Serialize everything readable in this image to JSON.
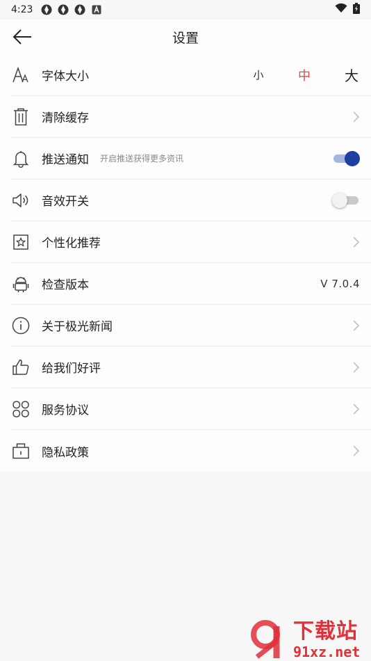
{
  "status_bar": {
    "time": "4:23"
  },
  "header": {
    "title": "设置"
  },
  "settings": {
    "font_size": {
      "label": "字体大小",
      "options": [
        "小",
        "中",
        "大"
      ],
      "selected": "中"
    },
    "clear_cache": {
      "label": "清除缓存"
    },
    "push": {
      "label": "推送通知",
      "sub": "开启推送获得更多资讯",
      "enabled": true
    },
    "sound": {
      "label": "音效开关",
      "enabled": false
    },
    "personal": {
      "label": "个性化推荐"
    },
    "version": {
      "label": "检查版本",
      "value": "V 7.0.4"
    },
    "about": {
      "label": "关于极光新闻"
    },
    "rate": {
      "label": "给我们好评"
    },
    "terms": {
      "label": "服务协议"
    },
    "privacy": {
      "label": "隐私政策"
    }
  },
  "watermark": {
    "brand": "下载站",
    "url": "91xz.net"
  },
  "colors": {
    "accent_red": "#e34c3f",
    "toggle_on": "#1d3fa0",
    "watermark_red": "#e0303a"
  }
}
